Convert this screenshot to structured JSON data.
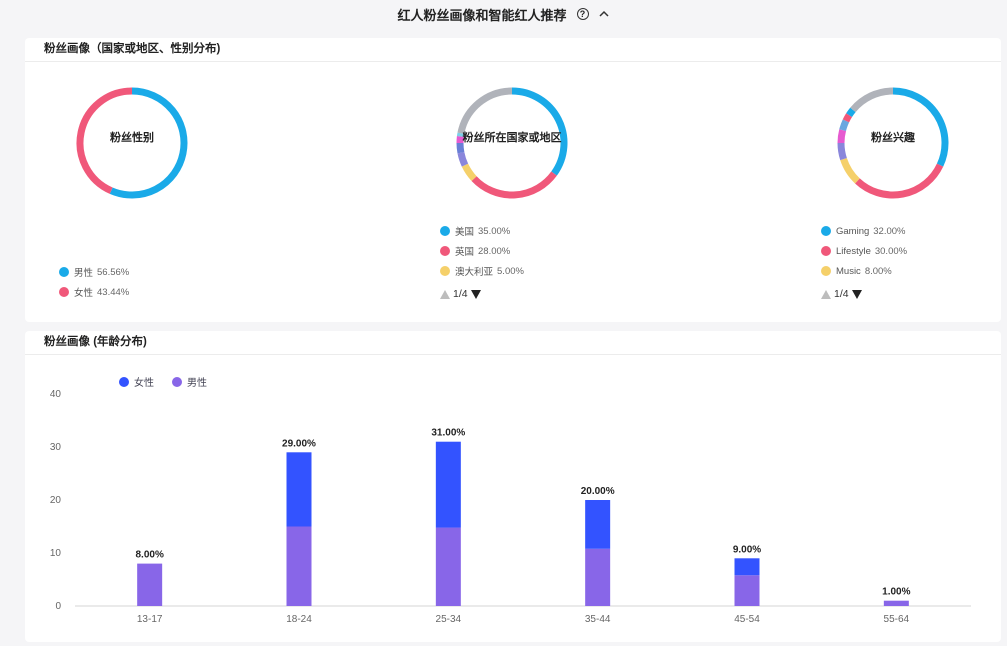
{
  "header": {
    "title": "红人粉丝画像和智能红人推荐",
    "help": "?"
  },
  "profile_card": {
    "title": "粉丝画像（国家或地区、性别分布)",
    "gender": {
      "center_label": "粉丝性别",
      "items": [
        {
          "label": "男性",
          "pct": "56.56%",
          "value": 56.56,
          "color": "#1aaae8"
        },
        {
          "label": "女性",
          "pct": "43.44%",
          "value": 43.44,
          "color": "#f0587a"
        }
      ]
    },
    "country": {
      "center_label": "粉丝所在国家或地区",
      "items": [
        {
          "label": "美国",
          "pct": "35.00%",
          "value": 35,
          "color": "#1aaae8"
        },
        {
          "label": "英国",
          "pct": "28.00%",
          "value": 28,
          "color": "#f0587a"
        },
        {
          "label": "澳大利亚",
          "pct": "5.00%",
          "value": 5,
          "color": "#f5d06a"
        }
      ],
      "other_segments": [
        {
          "value": 4,
          "color": "#8a86db"
        },
        {
          "value": 3,
          "color": "#6a7fd6"
        },
        {
          "value": 2,
          "color": "#e65ad0"
        },
        {
          "value": 1,
          "color": "#7bd0e8"
        },
        {
          "value": 22,
          "color": "#b0b3ba"
        }
      ],
      "pager": "1/4"
    },
    "interest": {
      "center_label": "粉丝兴趣",
      "items": [
        {
          "label": "Gaming",
          "pct": "32.00%",
          "value": 32,
          "color": "#1aaae8"
        },
        {
          "label": "Lifestyle",
          "pct": "30.00%",
          "value": 30,
          "color": "#f0587a"
        },
        {
          "label": "Music",
          "pct": "8.00%",
          "value": 8,
          "color": "#f5d06a"
        }
      ],
      "other_segments": [
        {
          "value": 5,
          "color": "#8a86db"
        },
        {
          "value": 4,
          "color": "#e65ad0"
        },
        {
          "value": 3,
          "color": "#6aa7e0"
        },
        {
          "value": 2,
          "color": "#f0587a"
        },
        {
          "value": 2,
          "color": "#1aaae8"
        },
        {
          "value": 14,
          "color": "#b0b3ba"
        }
      ],
      "pager": "1/4"
    }
  },
  "age_card": {
    "title": "粉丝画像  (年龄分布)",
    "legend": [
      {
        "label": "女性",
        "color": "#3353ff"
      },
      {
        "label": "男性",
        "color": "#8866e8"
      }
    ]
  },
  "chart_data": {
    "type": "bar",
    "stacked": true,
    "categories": [
      "13-17",
      "18-24",
      "25-34",
      "35-44",
      "45-54",
      "55-64"
    ],
    "series": [
      {
        "name": "男性",
        "color": "#8866e8",
        "values": [
          8,
          15,
          14.8,
          10.8,
          5.8,
          1
        ]
      },
      {
        "name": "女性",
        "color": "#3353ff",
        "values": [
          0,
          14,
          16.2,
          9.2,
          3.2,
          0
        ]
      }
    ],
    "totals": [
      "8.00%",
      "29.00%",
      "31.00%",
      "20.00%",
      "9.00%",
      "1.00%"
    ],
    "yticks": [
      "0",
      "10",
      "20",
      "30",
      "40"
    ],
    "ylim": [
      0,
      40
    ],
    "grid": false,
    "legend_position": "top-left"
  }
}
